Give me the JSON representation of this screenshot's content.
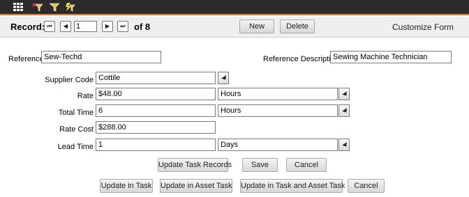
{
  "toolbar": {
    "icons": [
      "grid-icon",
      "filter-clear-icon",
      "filter-icon",
      "quick-filter-icon"
    ]
  },
  "nav": {
    "record_label": "Record:",
    "first_glyph": "⏮",
    "prev_glyph": "◀",
    "record_value": "1",
    "next_glyph": "▶",
    "last_glyph": "⏭",
    "of_text": "of 8",
    "new_label": "New",
    "delete_label": "Delete",
    "customize_label": "Customize Form"
  },
  "form": {
    "reference_label": "Reference",
    "reference_value": "Sew-Techd",
    "ref_desc_label": "Reference Description",
    "ref_desc_value": "Sewing Machine Technician",
    "supplier_label": "Supplier Code",
    "supplier_value": "Cottile",
    "rate_label": "Rate",
    "rate_value": "$48.00",
    "rate_unit": "Hours",
    "total_time_label": "Total Time",
    "total_time_value": "6",
    "total_time_unit": "Hours",
    "rate_cost_label": "Rate Cost",
    "rate_cost_value": "$288.00",
    "lead_time_label": "Lead Time",
    "lead_time_value": "1",
    "lead_time_unit": "Days"
  },
  "actions": {
    "update_task_records": "Update Task Records",
    "save": "Save",
    "cancel": "Cancel",
    "update_in_task": "Update in Task",
    "update_in_asset_task": "Update in Asset Task",
    "update_in_task_and_asset_task": "Update in Task and Asset Task",
    "cancel2": "Cancel"
  }
}
